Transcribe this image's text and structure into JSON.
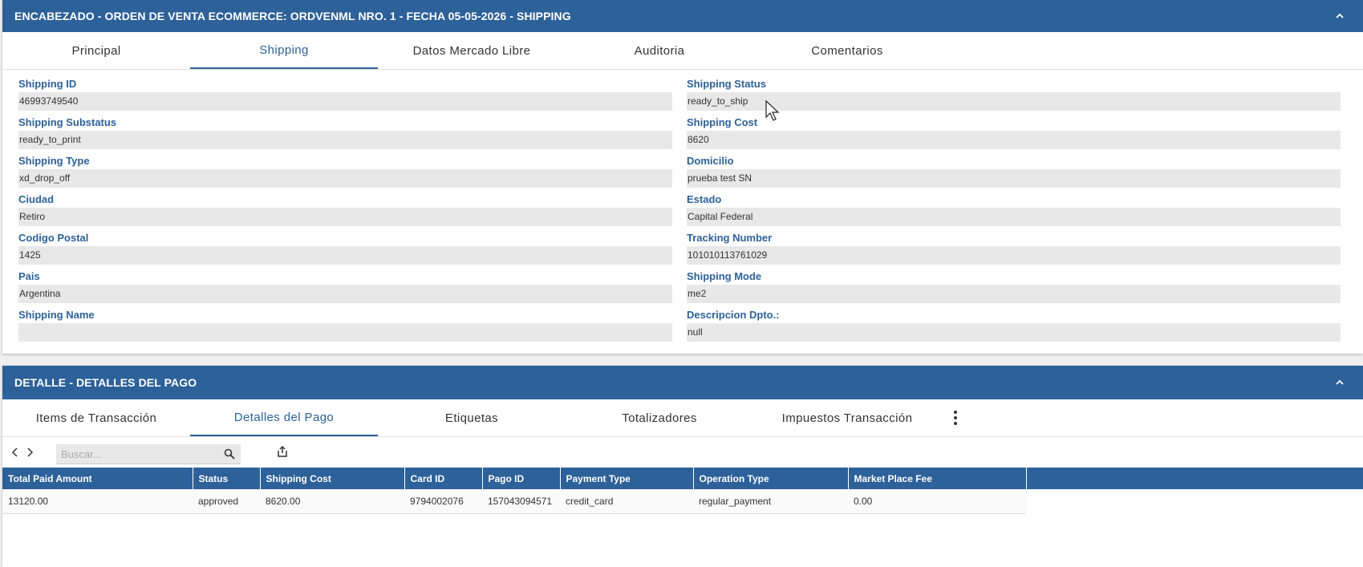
{
  "header_panel": {
    "title": "ENCABEZADO - ORDEN DE VENTA ECOMMERCE: ORDVENML NRO. 1 - FECHA 05-05-2026 - SHIPPING",
    "collapse_icon": "chevron-up-icon",
    "tabs": [
      {
        "label": "Principal",
        "active": false
      },
      {
        "label": "Shipping",
        "active": true
      },
      {
        "label": "Datos Mercado Libre",
        "active": false
      },
      {
        "label": "Auditoria",
        "active": false
      },
      {
        "label": "Comentarios",
        "active": false
      }
    ],
    "fields_left": [
      {
        "label": "Shipping ID",
        "value": "46993749540"
      },
      {
        "label": "Shipping Substatus",
        "value": "ready_to_print"
      },
      {
        "label": "Shipping Type",
        "value": "xd_drop_off"
      },
      {
        "label": "Ciudad",
        "value": "Retiro"
      },
      {
        "label": "Codigo Postal",
        "value": "1425"
      },
      {
        "label": "Pais",
        "value": "Argentina"
      },
      {
        "label": "Shipping Name",
        "value": ""
      }
    ],
    "fields_right": [
      {
        "label": "Shipping Status",
        "value": "ready_to_ship"
      },
      {
        "label": "Shipping Cost",
        "value": "8620"
      },
      {
        "label": "Domicilio",
        "value": "prueba test SN"
      },
      {
        "label": "Estado",
        "value": "Capital Federal"
      },
      {
        "label": "Tracking Number",
        "value": "101010113761029"
      },
      {
        "label": "Shipping Mode",
        "value": "me2"
      },
      {
        "label": "Descripcion Dpto.:",
        "value": "null"
      }
    ]
  },
  "detail_panel": {
    "title": "DETALLE - DETALLES DEL PAGO",
    "collapse_icon": "chevron-up-icon",
    "tabs": [
      {
        "label": "Items de Transacción",
        "active": false
      },
      {
        "label": "Detalles del Pago",
        "active": true
      },
      {
        "label": "Etiquetas",
        "active": false
      },
      {
        "label": "Totalizadores",
        "active": false
      },
      {
        "label": "Impuestos Transacción",
        "active": false
      }
    ],
    "more_icon": "more-vertical-icon",
    "toolbar": {
      "prev_icon": "chevron-left-icon",
      "next_icon": "chevron-right-icon",
      "search_placeholder": "Buscar...",
      "search_value": "",
      "search_icon": "search-icon",
      "export_icon": "export-icon"
    },
    "table": {
      "columns": [
        "Total Paid Amount",
        "Status",
        "Shipping Cost",
        "Card ID",
        "Pago ID",
        "Payment Type",
        "Operation Type",
        "Market Place Fee"
      ],
      "rows": [
        [
          "13120.00",
          "approved",
          "8620.00",
          "9794002076",
          "157043094571",
          "credit_card",
          "regular_payment",
          "0.00"
        ]
      ]
    }
  },
  "colors": {
    "header_bg": "#2d6199",
    "label_color": "#2d6199",
    "field_bg": "#e8e8e8",
    "active_tab": "#2d6199"
  }
}
